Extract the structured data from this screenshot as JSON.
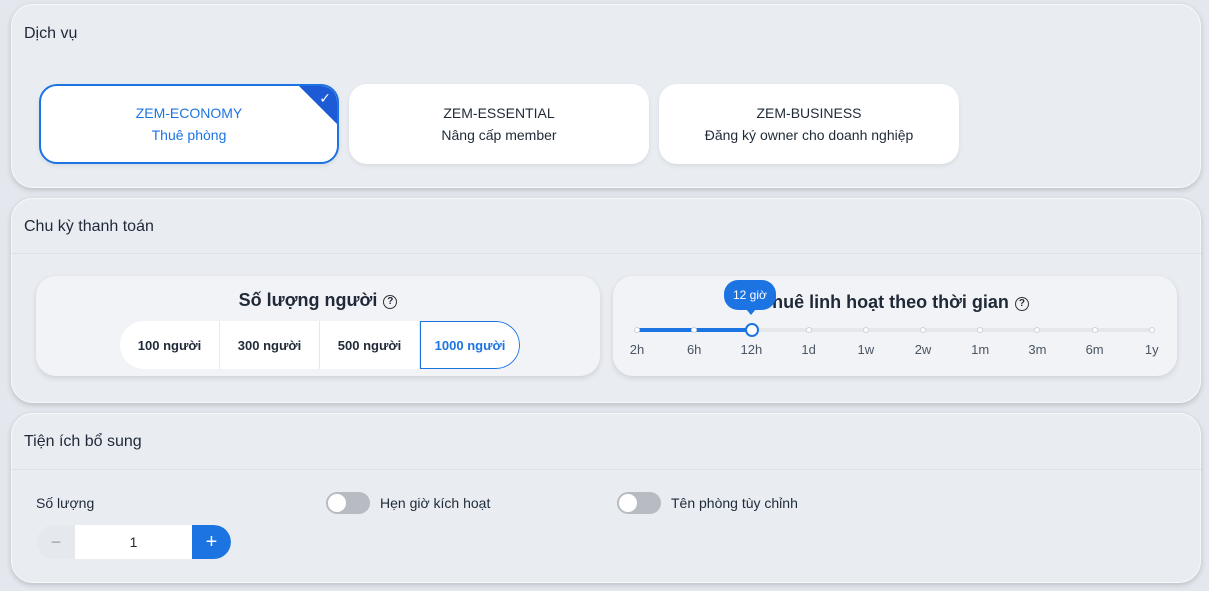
{
  "services": {
    "title": "Dịch vụ",
    "items": [
      {
        "name": "ZEM-ECONOMY",
        "desc": "Thuê phòng",
        "selected": true
      },
      {
        "name": "ZEM-ESSENTIAL",
        "desc": "Nâng cấp member",
        "selected": false
      },
      {
        "name": "ZEM-BUSINESS",
        "desc": "Đăng ký owner cho doanh nghiệp",
        "selected": false
      }
    ],
    "check_icon": "check-icon"
  },
  "billing": {
    "title": "Chu kỳ thanh toán",
    "people": {
      "title": "Số lượng người",
      "options": [
        "100 người",
        "300 người",
        "500 người",
        "1000 người"
      ],
      "selected": "1000 người"
    },
    "flex": {
      "title": "Thuê linh hoạt theo thời gian",
      "ticks": [
        "2h",
        "6h",
        "12h",
        "1d",
        "1w",
        "2w",
        "1m",
        "3m",
        "6m",
        "1y"
      ],
      "selected": "12h",
      "tooltip": "12 giờ"
    }
  },
  "extras": {
    "title": "Tiện ích bổ sung",
    "quantity_label": "Số lượng",
    "quantity_value": "1",
    "schedule_label": "Hẹn giờ kích hoạt",
    "schedule_on": false,
    "custom_room_label": "Tên phòng tùy chỉnh",
    "custom_room_on": false
  },
  "colors": {
    "accent": "#1c74e3",
    "corner": "#1c5ad6"
  }
}
